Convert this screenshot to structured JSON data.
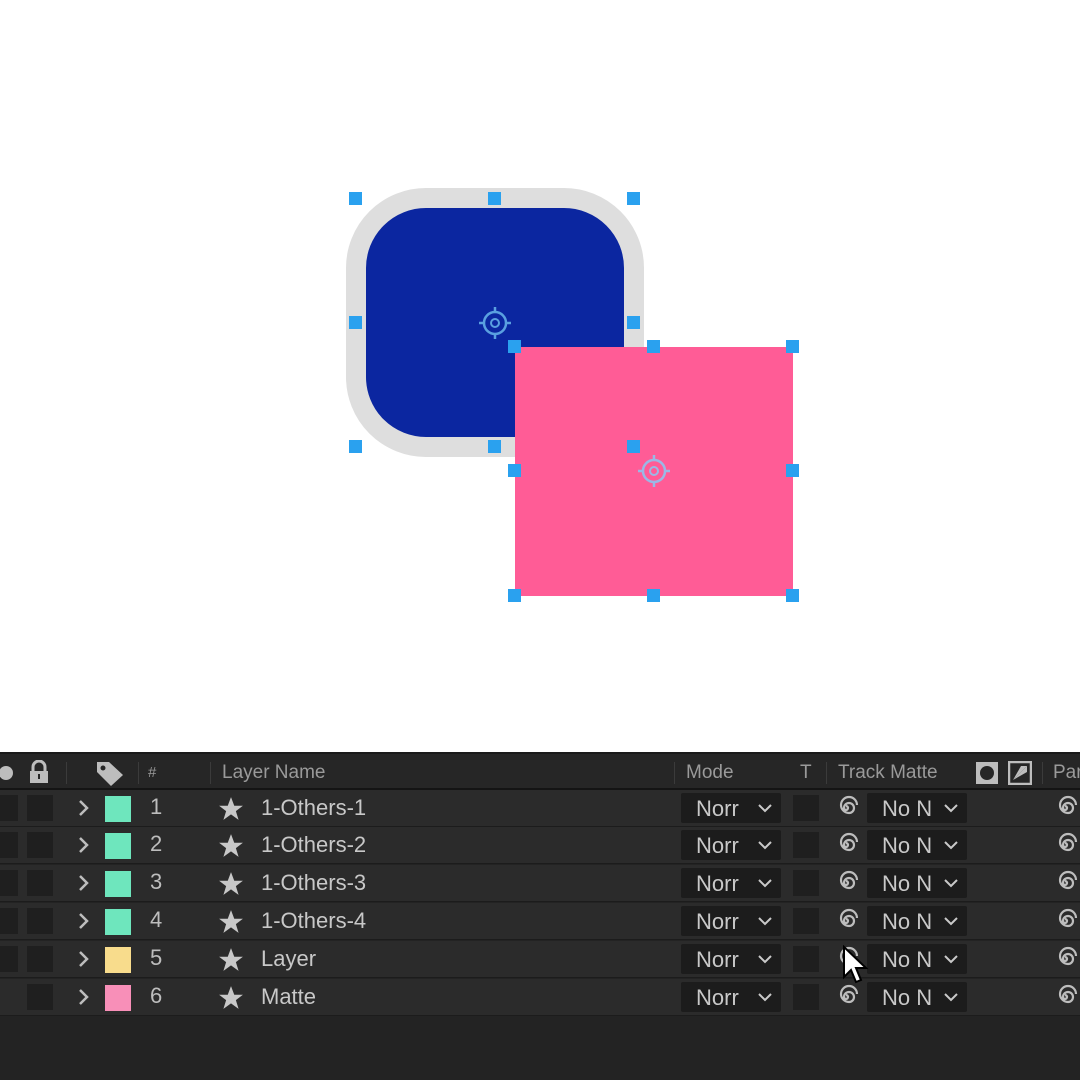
{
  "composition": {
    "shapes": [
      {
        "name": "rounded-square-blue",
        "fill": "#0b26a0",
        "stroke": "#dddddd"
      },
      {
        "name": "square-pink",
        "fill": "#ff5c96"
      }
    ],
    "handle_color": "#2aa1ef"
  },
  "timeline": {
    "headers": {
      "number": "#",
      "layer_name": "Layer Name",
      "mode": "Mode",
      "t": "T",
      "track_matte": "Track Matte",
      "parent": "Par"
    },
    "layers": [
      {
        "num": "1",
        "name": "1-Others-1",
        "color": "#6ee6bd",
        "mode": "Norr",
        "matte": "No N"
      },
      {
        "num": "2",
        "name": "1-Others-2",
        "color": "#6ee6bd",
        "mode": "Norr",
        "matte": "No N"
      },
      {
        "num": "3",
        "name": "1-Others-3",
        "color": "#6ee6bd",
        "mode": "Norr",
        "matte": "No N"
      },
      {
        "num": "4",
        "name": "1-Others-4",
        "color": "#6ee6bd",
        "mode": "Norr",
        "matte": "No N"
      },
      {
        "num": "5",
        "name": "Layer",
        "color": "#f8dc8c",
        "mode": "Norr",
        "matte": "No N"
      },
      {
        "num": "6",
        "name": "Matte",
        "color": "#f88fb8",
        "mode": "Norr",
        "matte": "No N"
      }
    ]
  }
}
